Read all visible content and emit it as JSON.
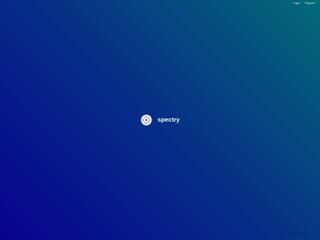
{
  "brand": {
    "name": "spectry",
    "logo_icon": "spectry-logo-icon"
  },
  "nav": {
    "login_label": "Login",
    "register_label": "Register"
  },
  "colors": {
    "gradient_start": "#07028f",
    "gradient_mid": "#062f86",
    "gradient_end": "#046a78",
    "text": "#ffffff"
  }
}
